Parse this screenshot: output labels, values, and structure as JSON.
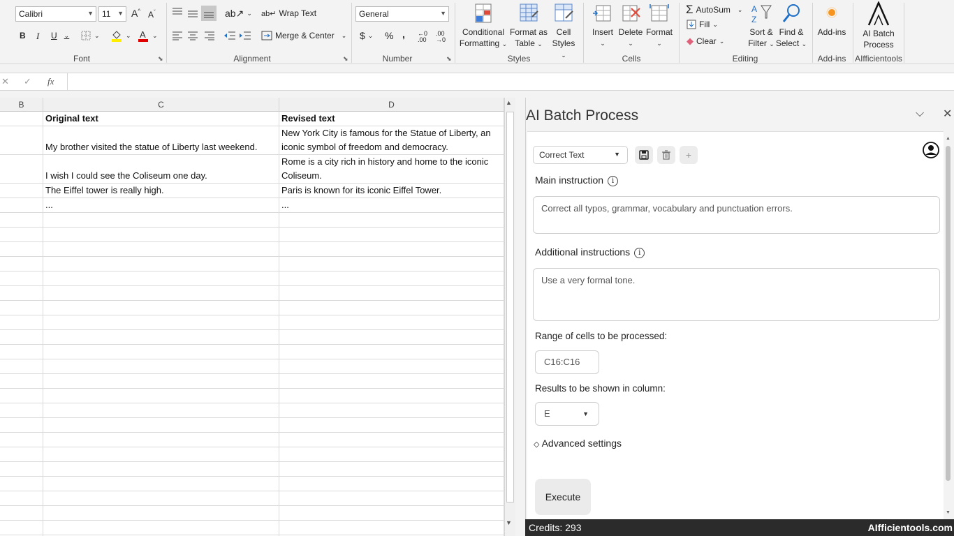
{
  "ribbon": {
    "font": {
      "name": "Calibri",
      "size": "11",
      "group_label": "Font",
      "bold": "B",
      "italic": "I",
      "underline": "U"
    },
    "alignment": {
      "wrap_text": "Wrap Text",
      "merge_center": "Merge & Center",
      "group_label": "Alignment"
    },
    "number": {
      "format": "General",
      "currency": "$",
      "percent": "%",
      "comma": "̦,",
      "group_label": "Number"
    },
    "styles": {
      "conditional_formatting_l1": "Conditional",
      "conditional_formatting_l2": "Formatting",
      "format_as_table_l1": "Format as",
      "format_as_table_l2": "Table",
      "cell_styles_l1": "Cell",
      "cell_styles_l2": "Styles",
      "group_label": "Styles"
    },
    "cells": {
      "insert": "Insert",
      "delete": "Delete",
      "format": "Format",
      "group_label": "Cells"
    },
    "editing": {
      "autosum": "AutoSum",
      "fill": "Fill",
      "clear": "Clear",
      "sort_filter_l1": "Sort &",
      "sort_filter_l2": "Filter",
      "find_select_l1": "Find &",
      "find_select_l2": "Select",
      "group_label": "Editing"
    },
    "addins": {
      "label": "Add-ins",
      "group_label": "Add-ins"
    },
    "ai_batch": {
      "label_l1": "AI Batch",
      "label_l2": "Process",
      "group_label": "AIfficientools"
    }
  },
  "formula_bar": {
    "cancel": "✕",
    "enter": "✓",
    "fx": "fx",
    "value": ""
  },
  "sheet": {
    "columns": [
      "B",
      "C",
      "D"
    ],
    "rows": [
      {
        "c": "Original text",
        "d_l1": "Revised text",
        "d_l2": "",
        "bold": true
      },
      {
        "c": "My brother visited the statue of Liberty last weekend.",
        "d_l1": "New York City is famous for the Statue of Liberty, an",
        "d_l2": "iconic symbol of freedom and democracy."
      },
      {
        "c": "I wish I could see the Coliseum one day.",
        "d_l1": "Rome is a city rich in history and home to the iconic",
        "d_l2": "Coliseum."
      },
      {
        "c": "The Eiffel tower is really high.",
        "d_l1": "Paris is known for its iconic Eiffel Tower.",
        "d_l2": ""
      },
      {
        "c": "...",
        "d_l1": "...",
        "d_l2": ""
      }
    ]
  },
  "panel": {
    "title": "AI Batch Process",
    "preset": "Correct Text",
    "main_instruction_label": "Main instruction",
    "main_instruction_value": "Correct all typos, grammar, vocabulary and punctuation errors.",
    "additional_instructions_label": "Additional instructions",
    "additional_instructions_value": "Use a very formal tone.",
    "range_label": "Range of cells to be processed:",
    "range_value": "C16:C16",
    "results_label": "Results to be shown in column:",
    "results_value": "E",
    "advanced_settings": "Advanced settings",
    "execute": "Execute",
    "credits": "Credits: 293",
    "brand": "AIfficientools.com"
  },
  "colors": {
    "ribbon_bg": "#f3f3f3",
    "footer_bg": "#2b2b2b",
    "addins_dot": "#f7941d",
    "font_color_bar": "#e00000",
    "fill_color_bar": "#ffee00"
  }
}
